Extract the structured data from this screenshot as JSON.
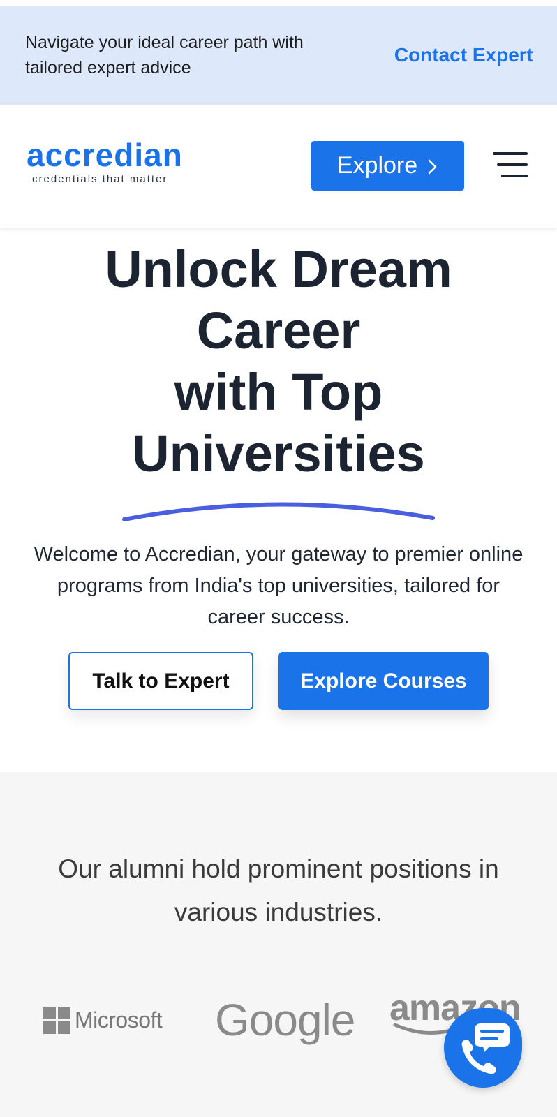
{
  "promo": {
    "text": "Navigate your ideal career path with tailored expert advice",
    "link": "Contact Expert"
  },
  "nav": {
    "logo": "accredian",
    "tagline": "credentials that matter",
    "explore": "Explore"
  },
  "hero": {
    "title_lines": [
      "Unlock Dream",
      "Career",
      "with Top",
      "Universities"
    ],
    "description": "Welcome to Accredian, your gateway to premier online programs from India's top universities, tailored for career success.",
    "talk_button": "Talk to Expert",
    "courses_button": "Explore Courses"
  },
  "alumni": {
    "text": "Our alumni hold prominent positions in various industries.",
    "companies": [
      "Microsoft",
      "Google",
      "amazon"
    ]
  },
  "colors": {
    "accent": "#1a73e8",
    "promo_bg": "#dde9fb",
    "heading": "#1c2431",
    "section_bg": "#f6f6f7",
    "underline": "#4a5fe0"
  },
  "icons": [
    "chevron-right-icon",
    "hamburger-menu-icon",
    "chat-call-icon"
  ]
}
